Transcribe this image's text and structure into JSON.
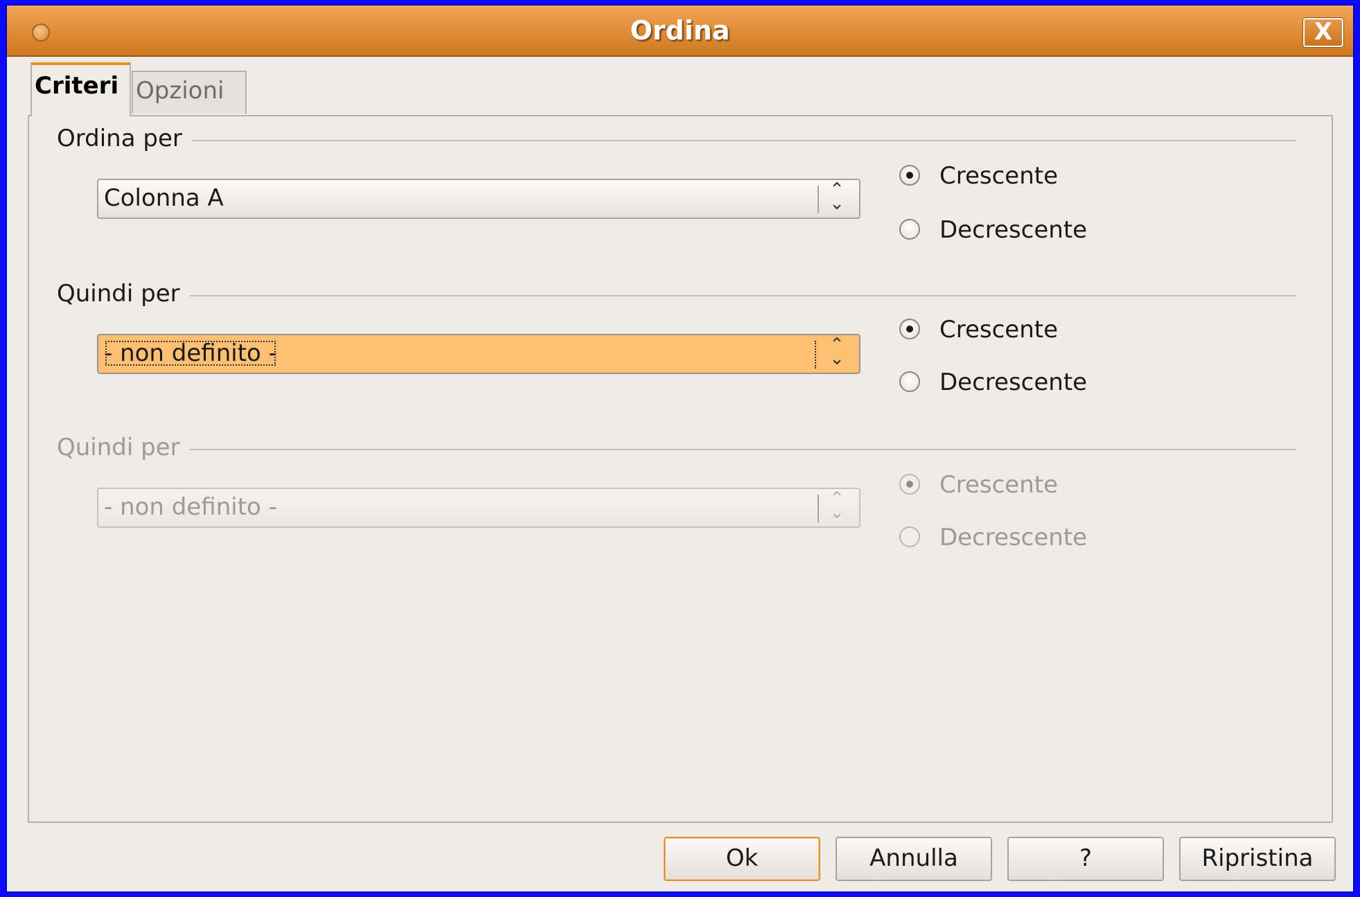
{
  "window": {
    "title": "Ordina",
    "close_label": "X"
  },
  "tabs": [
    {
      "label": "Criteri",
      "active": true
    },
    {
      "label": "Opzioni",
      "active": false
    }
  ],
  "groups": [
    {
      "label": "Ordina per",
      "combo_value": "Colonna A",
      "enabled": true,
      "focused": false,
      "ascending_label": "Crescente",
      "descending_label": "Decrescente",
      "selected": "ascending"
    },
    {
      "label": "Quindi per",
      "combo_value": "- non definito -",
      "enabled": true,
      "focused": true,
      "ascending_label": "Crescente",
      "descending_label": "Decrescente",
      "selected": "ascending"
    },
    {
      "label": "Quindi per",
      "combo_value": "- non definito -",
      "enabled": false,
      "focused": false,
      "ascending_label": "Crescente",
      "descending_label": "Decrescente",
      "selected": "ascending"
    }
  ],
  "buttons": {
    "ok": "Ok",
    "cancel": "Annulla",
    "help": "?",
    "reset": "Ripristina"
  },
  "colors": {
    "titlebar": "#e28f3a",
    "focus_highlight": "#ffbf73",
    "window_bg": "#efebe7"
  }
}
